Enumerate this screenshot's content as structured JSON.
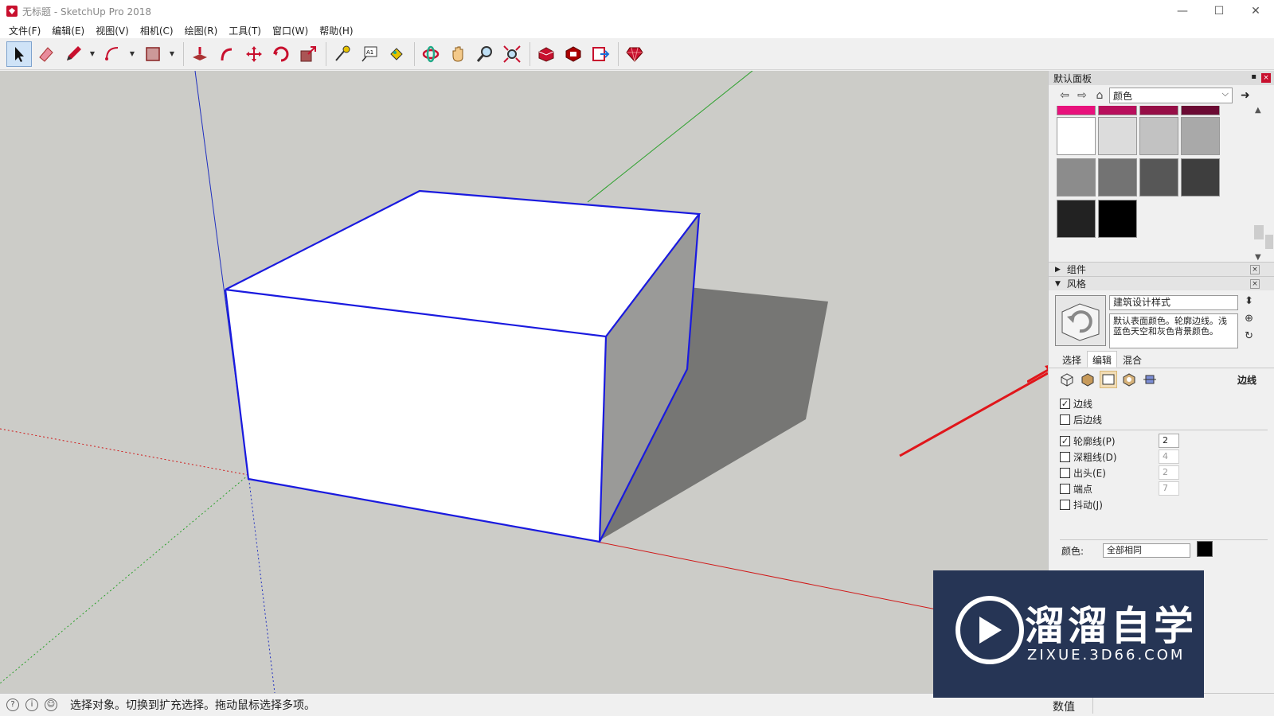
{
  "window": {
    "title": "无标题 - SketchUp Pro 2018",
    "minimize": "—",
    "maximize": "☐",
    "close": "✕"
  },
  "menu": [
    "文件(F)",
    "编辑(E)",
    "视图(V)",
    "相机(C)",
    "绘图(R)",
    "工具(T)",
    "窗口(W)",
    "帮助(H)"
  ],
  "toolbar": {
    "tools": [
      "select",
      "eraser",
      "pencil",
      "arc",
      "rectangle",
      "push-pull",
      "follow-me",
      "move",
      "rotate",
      "scale",
      "tape-measure",
      "text",
      "paint-bucket",
      "orbit",
      "pan",
      "zoom",
      "zoom-extents",
      "warehouse",
      "extension-warehouse",
      "send-to-layout",
      "extension-manager"
    ]
  },
  "tray": {
    "title": "默认面板",
    "pin": "▪",
    "close": "×",
    "materials": {
      "nav_back": "⇦",
      "nav_forward": "⇨",
      "nav_home": "⌂",
      "selected_collection": "颜色",
      "export_icon": "➜",
      "swatches": [
        "#e8127c",
        "#b80f5c",
        "#960e46",
        "#6b0a33",
        "#ffffff",
        "#dcdcdc",
        "#c2c2c2",
        "#a9a9a9",
        "#8c8c8c",
        "#737373",
        "#575757",
        "#3e3e3e",
        "#222222",
        "#000000"
      ]
    },
    "components_section": "组件",
    "styles_section": "风格",
    "style": {
      "name": "建筑设计样式",
      "description": "默认表面颜色。轮廓边线。浅蓝色天空和灰色背景颜色。",
      "tabs": [
        "选择",
        "编辑",
        "混合"
      ],
      "active_tab": 1,
      "edit_category": "边线"
    },
    "edge_settings": {
      "edges": {
        "label": "边线",
        "checked": true
      },
      "back_edges": {
        "label": "后边线",
        "checked": false
      },
      "profiles": {
        "label": "轮廓线(P)",
        "checked": true,
        "value": "2"
      },
      "depth_cue": {
        "label": "深粗线(D)",
        "checked": false,
        "value": "4"
      },
      "extension": {
        "label": "出头(E)",
        "checked": false,
        "value": "2"
      },
      "endpoints": {
        "label": "端点",
        "checked": false,
        "value": "7"
      },
      "jitter": {
        "label": "抖动(J)",
        "checked": false
      },
      "color_label": "颜色:",
      "color_value": "全部相同",
      "color_swatch": "#000000"
    }
  },
  "status": {
    "message": "选择对象。切换到扩充选择。拖动鼠标选择多项。",
    "value_label": "数值",
    "value": ""
  },
  "watermark": {
    "brand": "溜溜自学",
    "url": "ZIXUE.3D66.COM"
  },
  "colors": {
    "viewport_bg": "#ccccc8",
    "edge_highlight": "#1a1adf",
    "shadow": "#767674",
    "annotation_arrow": "#e0161b"
  }
}
